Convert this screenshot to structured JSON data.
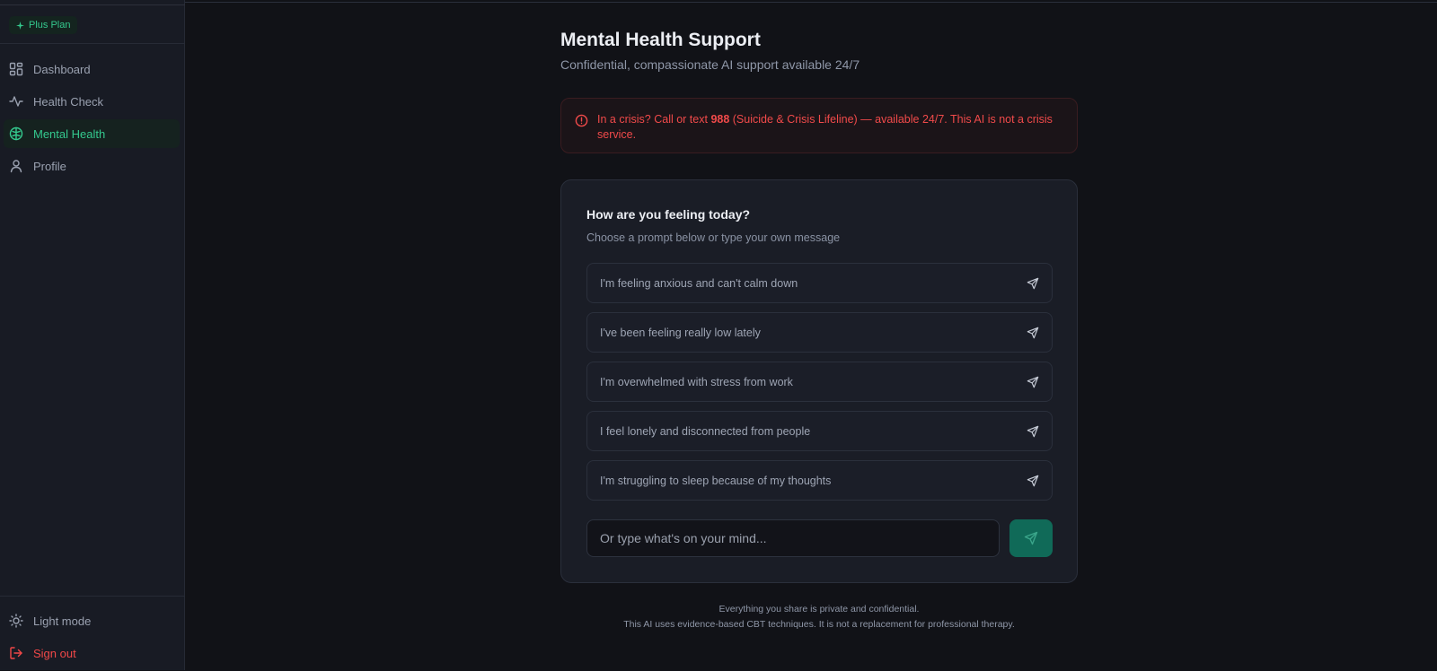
{
  "sidebar": {
    "plan_label": "Plus Plan",
    "nav": [
      {
        "label": "Dashboard",
        "icon": "dashboard-icon"
      },
      {
        "label": "Health Check",
        "icon": "activity-icon"
      },
      {
        "label": "Mental Health",
        "icon": "brain-icon",
        "active": true
      },
      {
        "label": "Profile",
        "icon": "user-icon"
      }
    ],
    "bottom": [
      {
        "label": "Light mode",
        "icon": "sun-icon"
      },
      {
        "label": "Sign out",
        "icon": "logout-icon"
      }
    ]
  },
  "header": {
    "title": "Mental Health Support",
    "subtitle": "Confidential, compassionate AI support available 24/7"
  },
  "alert": {
    "prefix": "In a crisis? Call or text ",
    "number": "988",
    "suffix": " (Suicide & Crisis Lifeline) — available 24/7. This AI is not a crisis service."
  },
  "card": {
    "title": "How are you feeling today?",
    "subtitle": "Choose a prompt below or type your own message",
    "prompts": [
      "I'm feeling anxious and can't calm down",
      "I've been feeling really low lately",
      "I'm overwhelmed with stress from work",
      "I feel lonely and disconnected from people",
      "I'm struggling to sleep because of my thoughts"
    ],
    "input_placeholder": "Or type what's on your mind..."
  },
  "footer": {
    "line1": "Everything you share is private and confidential.",
    "line2": "This AI uses evidence-based CBT techniques. It is not a replacement for professional therapy."
  },
  "colors": {
    "accent": "#34c98e",
    "danger": "#f14848",
    "send_button": "#106a58",
    "background": "#111217",
    "sidebar": "#181b24"
  }
}
